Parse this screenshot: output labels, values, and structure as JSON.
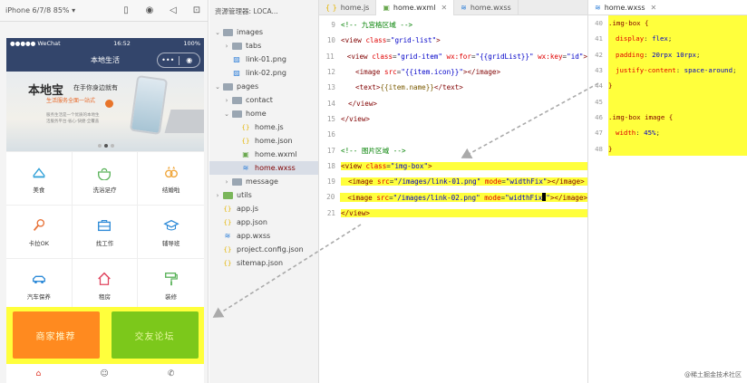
{
  "simulator": {
    "device": "iPhone 6/7/8 85% ▾",
    "status": {
      "carrier": "●●●●● WeChat",
      "time": "16:52",
      "battery": "100%"
    },
    "nav_title": "本地生活",
    "capsule": {
      "more": "•••",
      "close": "◉"
    },
    "banner": {
      "title": "本地宝",
      "slogan": "在手你身边就有",
      "subtitle": "生活服务全面一站式",
      "mini1": "服务生活是一个优质的本地生",
      "mini2": "活服务平台·省心·快捷·全覆盖"
    },
    "grid": [
      {
        "label": "美食",
        "icon": "food-icon",
        "color": "#2fa0d8"
      },
      {
        "label": "洗浴足疗",
        "icon": "bath-icon",
        "color": "#5bb35b"
      },
      {
        "label": "结婚啦",
        "icon": "rings-icon",
        "color": "#f0a63a"
      },
      {
        "label": "卡拉OK",
        "icon": "microphone-icon",
        "color": "#e8743a"
      },
      {
        "label": "找工作",
        "icon": "briefcase-icon",
        "color": "#2f8bd8"
      },
      {
        "label": "辅导班",
        "icon": "graduation-cap-icon",
        "color": "#2f8bd8"
      },
      {
        "label": "汽车保养",
        "icon": "car-icon",
        "color": "#2f8bd8"
      },
      {
        "label": "租房",
        "icon": "house-icon",
        "color": "#e0455f"
      },
      {
        "label": "装修",
        "icon": "paint-roller-icon",
        "color": "#5bb35b"
      }
    ],
    "cards": {
      "left": "商家推荐",
      "right": "交友论坛"
    },
    "tabbar": {
      "home": "⌂",
      "message": "☺",
      "contact": "✆"
    }
  },
  "explorer": {
    "header": "资源管理器: LOCA...",
    "tree": [
      {
        "label": "images",
        "depth": 0,
        "arrow": "⌄",
        "icon": "folder"
      },
      {
        "label": "tabs",
        "depth": 1,
        "arrow": "›",
        "icon": "folder"
      },
      {
        "label": "link-01.png",
        "depth": 1,
        "arrow": "",
        "icon": "image"
      },
      {
        "label": "link-02.png",
        "depth": 1,
        "arrow": "",
        "icon": "image"
      },
      {
        "label": "pages",
        "depth": 0,
        "arrow": "⌄",
        "icon": "folder"
      },
      {
        "label": "contact",
        "depth": 1,
        "arrow": "›",
        "icon": "folder"
      },
      {
        "label": "home",
        "depth": 1,
        "arrow": "⌄",
        "icon": "folder"
      },
      {
        "label": "home.js",
        "depth": 2,
        "arrow": "",
        "icon": "js"
      },
      {
        "label": "home.json",
        "depth": 2,
        "arrow": "",
        "icon": "json"
      },
      {
        "label": "home.wxml",
        "depth": 2,
        "arrow": "",
        "icon": "wxml"
      },
      {
        "label": "home.wxss",
        "depth": 2,
        "arrow": "",
        "icon": "wxss",
        "selected": true
      },
      {
        "label": "message",
        "depth": 1,
        "arrow": "›",
        "icon": "folder"
      },
      {
        "label": "utils",
        "depth": 0,
        "arrow": "›",
        "icon": "folder-green"
      },
      {
        "label": "app.js",
        "depth": 0,
        "arrow": "",
        "icon": "js"
      },
      {
        "label": "app.json",
        "depth": 0,
        "arrow": "",
        "icon": "json"
      },
      {
        "label": "app.wxss",
        "depth": 0,
        "arrow": "",
        "icon": "wxss"
      },
      {
        "label": "project.config.json",
        "depth": 0,
        "arrow": "",
        "icon": "json"
      },
      {
        "label": "sitemap.json",
        "depth": 0,
        "arrow": "",
        "icon": "json"
      }
    ]
  },
  "editor": {
    "tabs": [
      "home.js",
      "home.wxml",
      "home.wxss"
    ],
    "active_tab": "home.wxml",
    "css_tab": "home.wxss",
    "lines": [
      {
        "no": "9"
      },
      {
        "no": "10"
      },
      {
        "no": "11"
      },
      {
        "no": "12"
      },
      {
        "no": "13"
      },
      {
        "no": "14"
      },
      {
        "no": "15"
      },
      {
        "no": "16"
      },
      {
        "no": "17"
      },
      {
        "no": "18"
      },
      {
        "no": "19"
      },
      {
        "no": "20"
      },
      {
        "no": "21"
      }
    ],
    "css_lines": [
      {
        "no": "40"
      },
      {
        "no": "41"
      },
      {
        "no": "42"
      },
      {
        "no": "43"
      },
      {
        "no": "44"
      },
      {
        "no": "45"
      },
      {
        "no": "46"
      },
      {
        "no": "47"
      },
      {
        "no": "48"
      }
    ]
  },
  "watermark": "@稀土掘金技术社区",
  "colors": {
    "highlight": "#ffff3c",
    "nav": "#33456b",
    "card_left": "#ff8a1f",
    "card_right": "#7cc81b"
  }
}
